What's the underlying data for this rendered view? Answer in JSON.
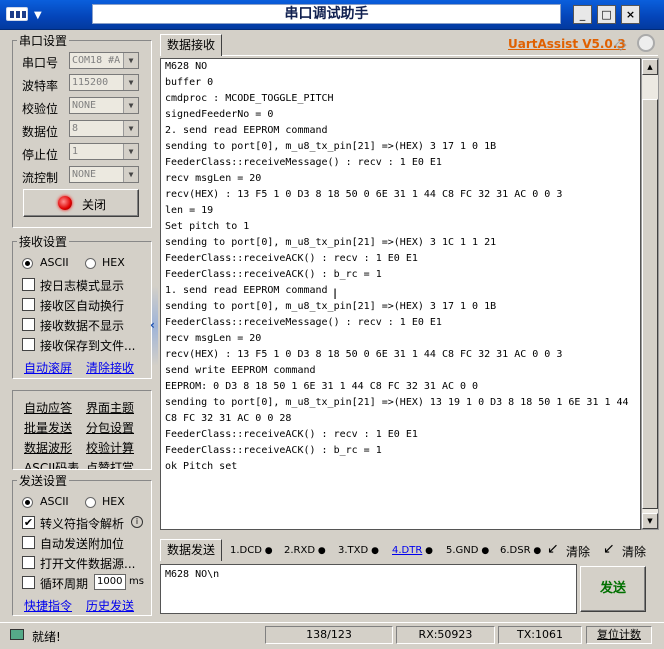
{
  "window": {
    "title": "串口调试助手",
    "min_label": "_",
    "max_label": "□",
    "close_label": "×"
  },
  "serial": {
    "group_title": "串口设置",
    "port_label": "串口号",
    "port_value": "COM18 #A",
    "baud_label": "波特率",
    "baud_value": "115200",
    "parity_label": "校验位",
    "parity_value": "NONE",
    "data_label": "数据位",
    "data_value": "8",
    "stop_label": "停止位",
    "stop_value": "1",
    "flow_label": "流控制",
    "flow_value": "NONE",
    "close_button": "关闭"
  },
  "recv_settings": {
    "group_title": "接收设置",
    "ascii": "ASCII",
    "hex": "HEX",
    "options": [
      "按日志模式显示",
      "接收区自动换行",
      "接收数据不显示",
      "接收保存到文件..."
    ],
    "auto_scroll": "自动滚屏",
    "clear_recv": "清除接收"
  },
  "tools": {
    "items": [
      "自动应答",
      "界面主题",
      "批量发送",
      "分包设置",
      "数据波形",
      "校验计算",
      "ASCII码表",
      "点赞打赏"
    ]
  },
  "send_settings": {
    "group_title": "发送设置",
    "ascii": "ASCII",
    "hex": "HEX",
    "options": [
      "转义符指令解析",
      "自动发送附加位",
      "打开文件数据源...",
      "循环周期"
    ],
    "period_value": "1000",
    "period_unit": "ms",
    "shortcut": "快捷指令",
    "history": "历史发送"
  },
  "recv_panel": {
    "tab": "数据接收",
    "app_name": "UartAssist V5.0.3",
    "lines": [
      "M628 NO",
      "buffer 0",
      "cmdproc : MCODE_TOGGLE_PITCH",
      "signedFeederNo = 0",
      "2. send read EEPROM command",
      "sending to port[0], m_u8_tx_pin[21] =>(HEX) 3 17 1 0 1B",
      "FeederClass::receiveMessage() : recv : 1 E0 E1",
      "recv msgLen = 20",
      "recv(HEX) : 13 F5 1 0 D3 8 18 50 0 6E 31 1 44 C8 FC 32 31 AC 0 0 3",
      "len = 19",
      "Set pitch to 1",
      "sending to port[0], m_u8_tx_pin[21] =>(HEX) 3 1C 1 1 21",
      "FeederClass::receiveACK() : recv : 1 E0 E1",
      "FeederClass::receiveACK() : b_rc = 1",
      "1. send read EEPROM command",
      "sending to port[0], m_u8_tx_pin[21] =>(HEX) 3 17 1 0 1B",
      "FeederClass::receiveMessage() : recv : 1 E0 E1",
      "recv msgLen = 20",
      "recv(HEX) : 13 F5 1 0 D3 8 18 50 0 6E 31 1 44 C8 FC 32 31 AC 0 0 3",
      "send write EEPROM command",
      "EEPROM: 0 D3 8 18 50 1 6E 31 1 44 C8 FC 32 31 AC 0 0",
      "sending to port[0], m_u8_tx_pin[21] =>(HEX) 13 19 1 0 D3 8 18 50 1 6E 31 1 44",
      "C8 FC 32 31 AC 0 0 28",
      "FeederClass::receiveACK() : recv : 1 E0 E1",
      "FeederClass::receiveACK() : b_rc = 1",
      "ok Pitch set"
    ]
  },
  "send_panel": {
    "tab": "数据发送",
    "signals": [
      "1.DCD",
      "2.RXD",
      "3.TXD",
      "4.DTR",
      "5.GND",
      "6.DSR"
    ],
    "clear1": "清除",
    "clear2": "清除",
    "input_value": "M628 NO\\n",
    "send_button": "发送"
  },
  "status": {
    "ready": "就绪!",
    "counter": "138/123",
    "rx": "RX:50923",
    "tx": "TX:1061",
    "reset": "复位计数"
  },
  "colors": {
    "title_blue": "#0444b8",
    "link": "#0000ee",
    "app_name": "#e06000",
    "led_red": "#e00000",
    "send_green": "#007000"
  }
}
